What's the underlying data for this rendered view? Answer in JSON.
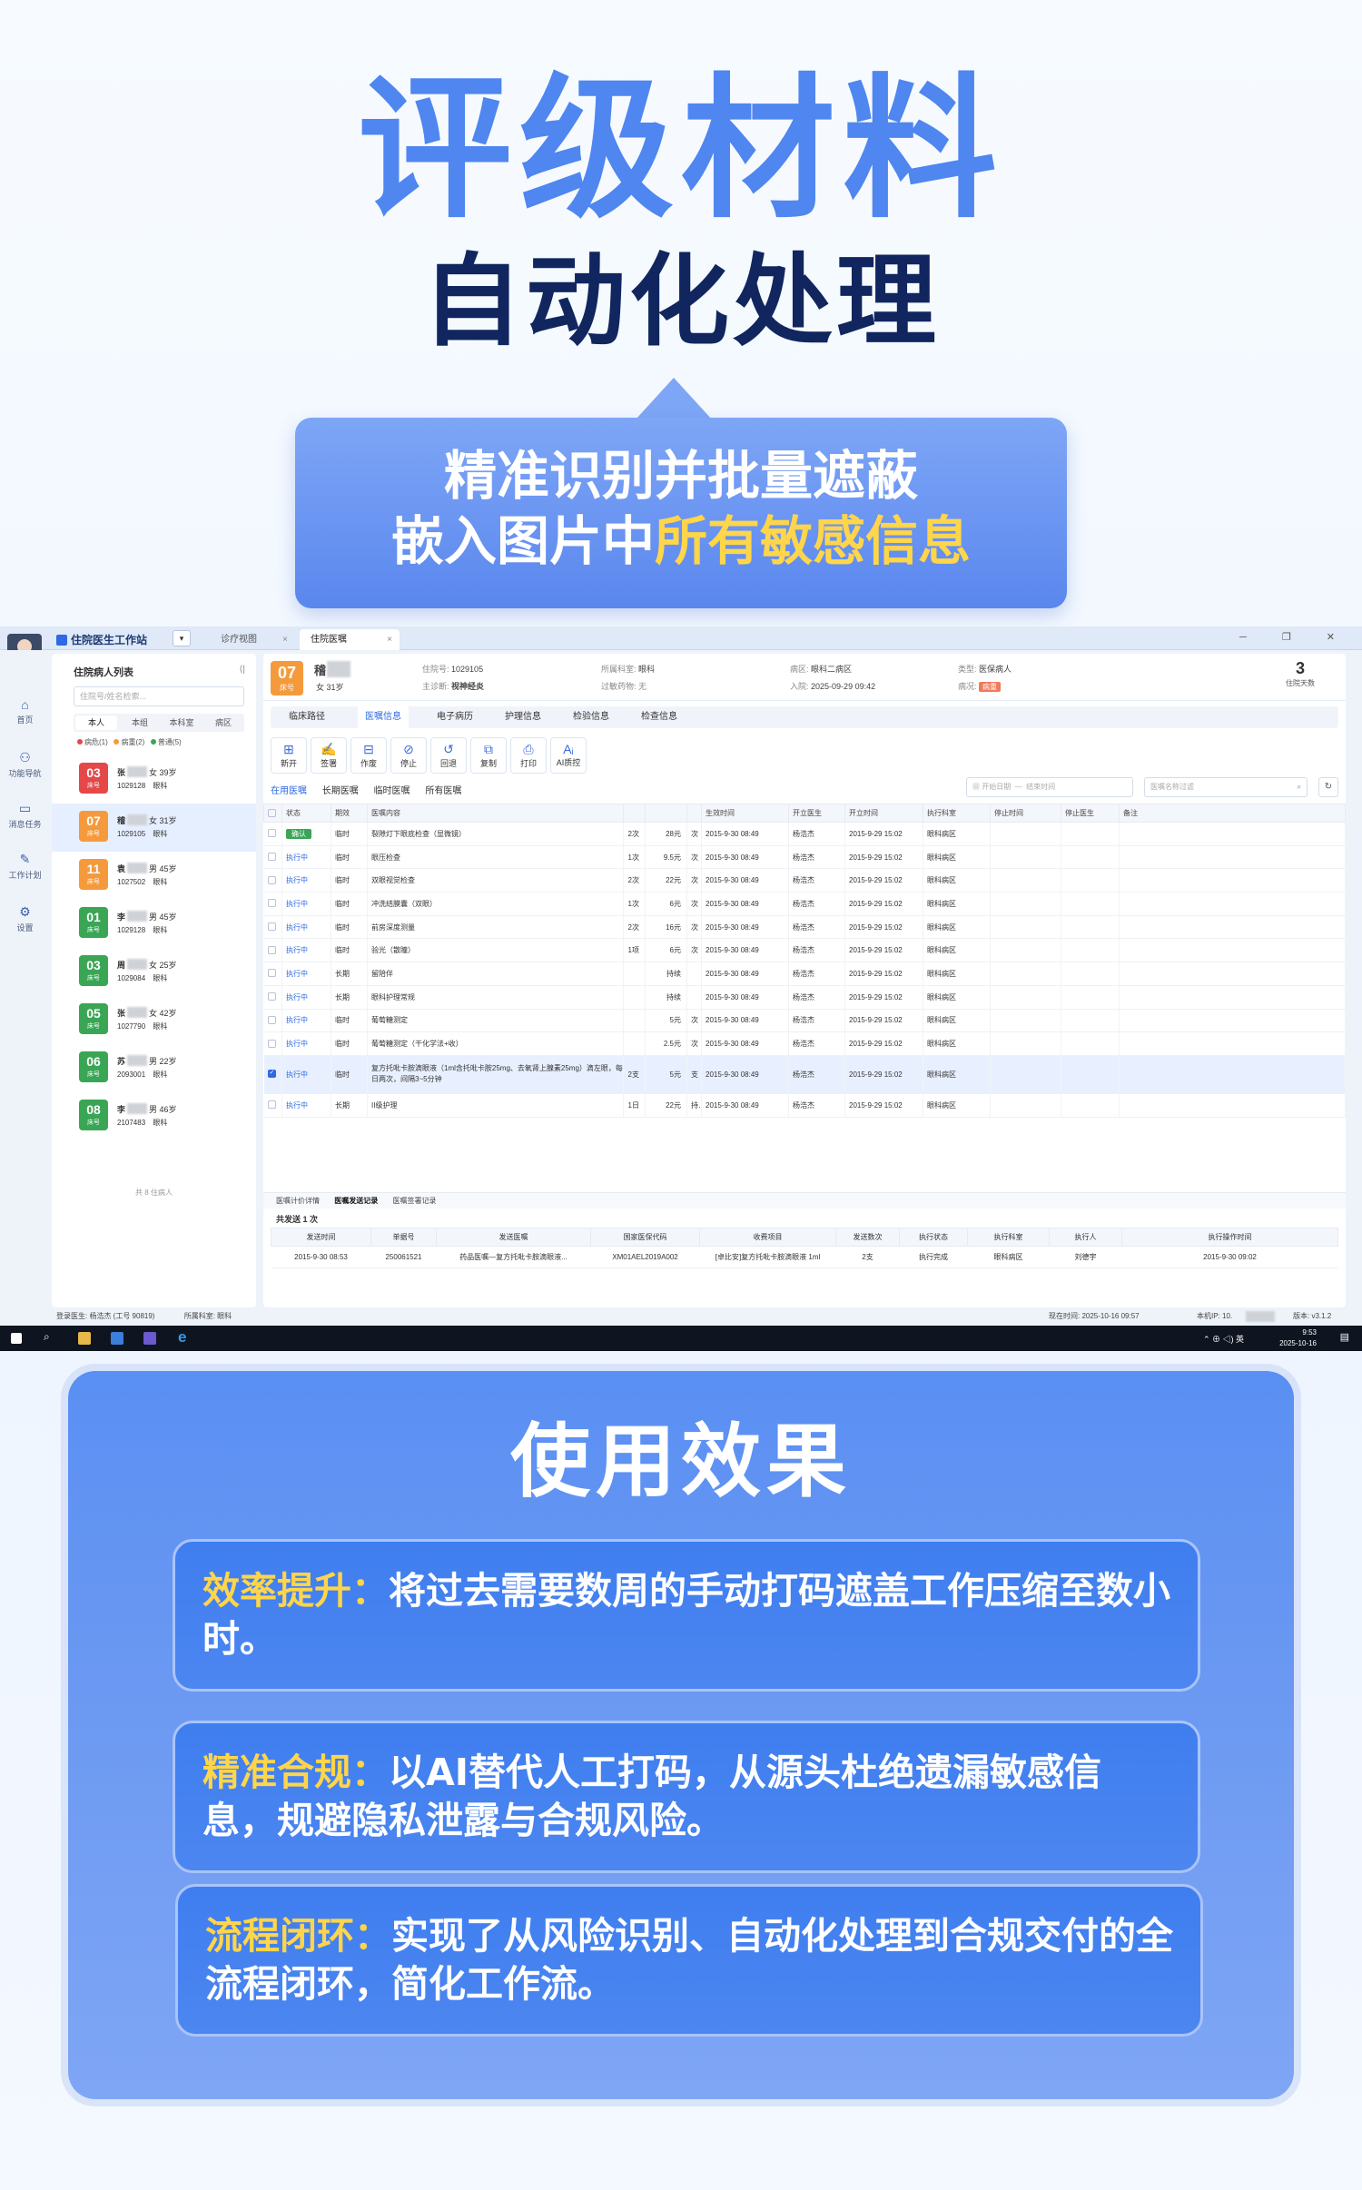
{
  "hero": {
    "title": "评级材料",
    "subtitle": "自动化处理",
    "banner_line1": "精准识别并批量遮蔽",
    "banner_line2_prefix": "嵌入图片中",
    "banner_line2_highlight": "所有敏感信息"
  },
  "app": {
    "title": "住院医生工作站",
    "tabs": [
      "诊疗视图",
      "住院医嘱"
    ],
    "left_nav": [
      {
        "icon": "home-icon",
        "label": "首页"
      },
      {
        "icon": "nav-icon",
        "label": "功能导航"
      },
      {
        "icon": "message-icon",
        "label": "消息任务"
      },
      {
        "icon": "plan-icon",
        "label": "工作计划"
      },
      {
        "icon": "settings-icon",
        "label": "设置"
      }
    ],
    "patient_list": {
      "title": "住院病人列表",
      "search_placeholder": "住院号/姓名检索...",
      "tabs": [
        "本人",
        "本组",
        "本科室",
        "病区"
      ],
      "legend": [
        {
          "label": "病危(1)",
          "color": "#e54848"
        },
        {
          "label": "病重(2)",
          "color": "#f59a3c"
        },
        {
          "label": "普通(5)",
          "color": "#3aa655"
        }
      ],
      "patients": [
        {
          "bed": "03",
          "bed_label": "床号",
          "name": "张",
          "info": "女 39岁",
          "id": "1029128",
          "dept": "眼科",
          "color": "#e54848"
        },
        {
          "bed": "07",
          "bed_label": "床号",
          "name": "稽",
          "info": "女 31岁",
          "id": "1029105",
          "dept": "眼科",
          "color": "#f59a3c"
        },
        {
          "bed": "11",
          "bed_label": "床号",
          "name": "袁",
          "info": "男 45岁",
          "id": "1027502",
          "dept": "眼科",
          "color": "#f59a3c"
        },
        {
          "bed": "01",
          "bed_label": "床号",
          "name": "李",
          "info": "男 45岁",
          "id": "1029128",
          "dept": "眼科",
          "color": "#3aa655"
        },
        {
          "bed": "03",
          "bed_label": "床号",
          "name": "周",
          "info": "女 25岁",
          "id": "1029084",
          "dept": "眼科",
          "color": "#3aa655"
        },
        {
          "bed": "05",
          "bed_label": "床号",
          "name": "张",
          "info": "女 42岁",
          "id": "1027790",
          "dept": "眼科",
          "color": "#3aa655"
        },
        {
          "bed": "06",
          "bed_label": "床号",
          "name": "苏",
          "info": "男 22岁",
          "id": "2093001",
          "dept": "眼科",
          "color": "#3aa655"
        },
        {
          "bed": "08",
          "bed_label": "床号",
          "name": "李",
          "info": "男 46岁",
          "id": "2107483",
          "dept": "眼科",
          "color": "#3aa655"
        }
      ],
      "footer": "共 8 住病人"
    },
    "header": {
      "bed": "07",
      "bed_label": "床号",
      "name": "稽",
      "gender_age": "女  31岁",
      "admission_no_label": "住院号:",
      "admission_no": "1029105",
      "diagnosis_label": "主诊断:",
      "diagnosis": "视神经炎",
      "dept_label": "所属科室:",
      "dept": "眼科",
      "allergy_label": "过敏药物:",
      "allergy": "无",
      "ward_label": "病区:",
      "ward": "眼科二病区",
      "admit_label": "入院:",
      "admit": "2025-09-29 09:42",
      "type_label": "类型:",
      "type": "医保病人",
      "condition_label": "病况:",
      "condition": "病重",
      "days": "3",
      "days_label": "住院天数"
    },
    "main_tabs": [
      "临床路径",
      "医嘱信息",
      "电子病历",
      "护理信息",
      "检验信息",
      "检查信息"
    ],
    "toolbar": [
      {
        "icon": "new-icon",
        "label": "新开"
      },
      {
        "icon": "sign-icon",
        "label": "签署"
      },
      {
        "icon": "void-icon",
        "label": "作废"
      },
      {
        "icon": "stop-icon",
        "label": "停止"
      },
      {
        "icon": "revoke-icon",
        "label": "回退"
      },
      {
        "icon": "copy-icon",
        "label": "复制"
      },
      {
        "icon": "print-icon",
        "label": "打印"
      },
      {
        "icon": "ai-icon",
        "label": "AI质控"
      }
    ],
    "sub_tabs": [
      "在用医嘱",
      "长期医嘱",
      "临时医嘱",
      "所有医嘱"
    ],
    "filter": {
      "start_placeholder": "开始日期",
      "end_placeholder": "结束时间",
      "search_placeholder": "医嘱名称过滤"
    },
    "order_columns": [
      "状态",
      "期效",
      "医嘱内容",
      "",
      "",
      "",
      "生效时间",
      "开立医生",
      "开立时间",
      "执行科室",
      "停止时间",
      "停止医生",
      "备注"
    ],
    "orders": [
      {
        "checked": false,
        "status": "确认",
        "term": "临时",
        "content": "裂隙灯下眼底检查（显微镜）",
        "qty": "2次",
        "price": "28元",
        "unit": "次",
        "start": "2015-9-30  08:49",
        "doctor": "杨浩杰",
        "open": "2015-9-29  15:02",
        "dept": "眼科病区"
      },
      {
        "checked": false,
        "status": "执行中",
        "term": "临时",
        "content": "眼压检查",
        "qty": "1次",
        "price": "9.5元",
        "unit": "次",
        "start": "2015-9-30  08:49",
        "doctor": "杨浩杰",
        "open": "2015-9-29  15:02",
        "dept": "眼科病区"
      },
      {
        "checked": false,
        "status": "执行中",
        "term": "临时",
        "content": "双眼视觉检查",
        "qty": "2次",
        "price": "22元",
        "unit": "次",
        "start": "2015-9-30  08:49",
        "doctor": "杨浩杰",
        "open": "2015-9-29  15:02",
        "dept": "眼科病区"
      },
      {
        "checked": false,
        "status": "执行中",
        "term": "临时",
        "content": "冲洗结膜囊（双眼）",
        "qty": "1次",
        "price": "6元",
        "unit": "次",
        "start": "2015-9-30  08:49",
        "doctor": "杨浩杰",
        "open": "2015-9-29  15:02",
        "dept": "眼科病区"
      },
      {
        "checked": false,
        "status": "执行中",
        "term": "临时",
        "content": "前房深度测量",
        "qty": "2次",
        "price": "16元",
        "unit": "次",
        "start": "2015-9-30  08:49",
        "doctor": "杨浩杰",
        "open": "2015-9-29  15:02",
        "dept": "眼科病区"
      },
      {
        "checked": false,
        "status": "执行中",
        "term": "临时",
        "content": "验光（散瞳）",
        "qty": "1项",
        "price": "6元",
        "unit": "次",
        "start": "2015-9-30  08:49",
        "doctor": "杨浩杰",
        "open": "2015-9-29  15:02",
        "dept": "眼科病区"
      },
      {
        "checked": false,
        "status": "执行中",
        "term": "长期",
        "content": "留陪伴",
        "qty": "",
        "price": "持续",
        "unit": "",
        "start": "2015-9-30  08:49",
        "doctor": "杨浩杰",
        "open": "2015-9-29  15:02",
        "dept": "眼科病区"
      },
      {
        "checked": false,
        "status": "执行中",
        "term": "长期",
        "content": "眼科护理常规",
        "qty": "",
        "price": "持续",
        "unit": "",
        "start": "2015-9-30  08:49",
        "doctor": "杨浩杰",
        "open": "2015-9-29  15:02",
        "dept": "眼科病区"
      },
      {
        "checked": false,
        "status": "执行中",
        "term": "临时",
        "content": "葡萄糖测定",
        "qty": "",
        "price": "5元",
        "unit": "次",
        "start": "2015-9-30  08:49",
        "doctor": "杨浩杰",
        "open": "2015-9-29  15:02",
        "dept": "眼科病区"
      },
      {
        "checked": false,
        "status": "执行中",
        "term": "临时",
        "content": "葡萄糖测定（干化学法+收）",
        "qty": "",
        "price": "2.5元",
        "unit": "次",
        "start": "2015-9-30  08:49",
        "doctor": "杨浩杰",
        "open": "2015-9-29  15:02",
        "dept": "眼科病区"
      },
      {
        "checked": true,
        "status": "执行中",
        "term": "临时",
        "content": "复方托吡卡胺滴眼液（1ml含托吡卡胺25mg、去氧肾上腺素25mg）滴左眼，每日两次，间隔3~5分钟",
        "qty": "2支",
        "price": "5元",
        "unit": "支",
        "start": "2015-9-30  08:49",
        "doctor": "杨浩杰",
        "open": "2015-9-29  15:02",
        "dept": "眼科病区"
      },
      {
        "checked": false,
        "status": "执行中",
        "term": "长期",
        "content": "II级护理",
        "qty": "1日",
        "price": "22元",
        "unit": "持续",
        "start": "2015-9-30  08:49",
        "doctor": "杨浩杰",
        "open": "2015-9-29  15:02",
        "dept": "眼科病区"
      }
    ],
    "bottom_tabs": [
      "医嘱计价详情",
      "医嘱发送记录",
      "医嘱签署记录"
    ],
    "send_total": "共发送  1  次",
    "send_columns": [
      "发送时间",
      "单据号",
      "发送医嘱",
      "国家医保代码",
      "收费项目",
      "发送数次",
      "执行状态",
      "执行科室",
      "执行人",
      "执行操作时间"
    ],
    "send_rows": [
      [
        "2015-9-30  08:53",
        "250061521",
        "药品医嘱—复方托吡卡胺滴眼液...",
        "XM01AEL2019A002",
        "[卓比安]复方托吡卡胺滴眼液 1ml",
        "2支",
        "执行完成",
        "眼科病区",
        "刘德宇",
        "2015-9-30  09:02"
      ]
    ],
    "statusbar": {
      "login": "登录医生: 杨浩杰 (工号 90819)",
      "dept": "所属科室: 眼科",
      "time": "现在时间: 2025-10-16 09:57",
      "ip": "本机IP: 10.",
      "version": "版本: v3.1.2"
    },
    "taskbar": {
      "time": "9:53",
      "date": "2025-10-16",
      "lang": "英"
    }
  },
  "effects": {
    "title": "使用效果",
    "items": [
      {
        "key": "效率提升：",
        "text": "将过去需要数周的手动打码遮盖工作压缩至数小时。"
      },
      {
        "key": "精准合规：",
        "text": "以AI替代人工打码，从源头杜绝遗漏敏感信息，规避隐私泄露与合规风险。"
      },
      {
        "key": "流程闭环：",
        "text": "实现了从风险识别、自动化处理到合规交付的全流程闭环，简化工作流。"
      }
    ]
  }
}
